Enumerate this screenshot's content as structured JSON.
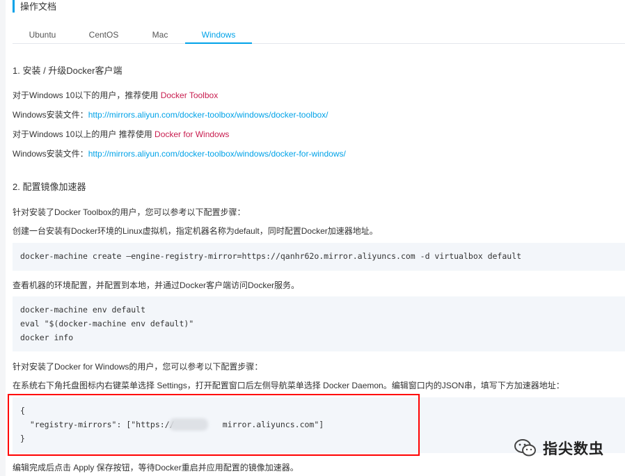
{
  "header": {
    "title": "操作文档"
  },
  "tabs": [
    {
      "label": "Ubuntu"
    },
    {
      "label": "CentOS"
    },
    {
      "label": "Mac"
    },
    {
      "label": "Windows"
    }
  ],
  "section1": {
    "title": "1. 安装 / 升级Docker客户端",
    "line1_prefix": "对于Windows 10以下的用户，推荐使用 ",
    "line1_link": "Docker Toolbox",
    "line2_prefix": "Windows安装文件：",
    "line2_url": "http://mirrors.aliyun.com/docker-toolbox/windows/docker-toolbox/",
    "line3_prefix": "对于Windows 10以上的用户 推荐使用 ",
    "line3_link": "Docker for Windows",
    "line4_prefix": "Windows安装文件：",
    "line4_url": "http://mirrors.aliyun.com/docker-toolbox/windows/docker-for-windows/"
  },
  "section2": {
    "title": "2. 配置镜像加速器",
    "p1": "针对安装了Docker Toolbox的用户，您可以参考以下配置步骤：",
    "p2": "创建一台安装有Docker环境的Linux虚拟机，指定机器名称为default，同时配置Docker加速器地址。",
    "code1": "docker-machine create —engine-registry-mirror=https://qanhr62o.mirror.aliyuncs.com -d virtualbox default",
    "p3": "查看机器的环境配置，并配置到本地，并通过Docker客户端访问Docker服务。",
    "code2": [
      "docker-machine env default",
      "eval \"$(docker-machine env default)\"",
      "docker info"
    ],
    "p4": "针对安装了Docker for Windows的用户，您可以参考以下配置步骤：",
    "p5": "在系统右下角托盘图标内右键菜单选择 Settings，打开配置窗口后左侧导航菜单选择 Docker Daemon。编辑窗口内的JSON串，填写下方加速器地址：",
    "code3": [
      "{",
      "  \"registry-mirrors\": [\"https://          mirror.aliyuncs.com\"]",
      "}"
    ],
    "p6": "编辑完成后点击 Apply 保存按钮，等待Docker重启并应用配置的镜像加速器。"
  },
  "watermark": {
    "text": "指尖数虫"
  },
  "colors": {
    "accent": "#00a2e8",
    "link_red": "#c81d4f",
    "code_bg": "#f3f6fa",
    "highlight": "#ff0000"
  }
}
